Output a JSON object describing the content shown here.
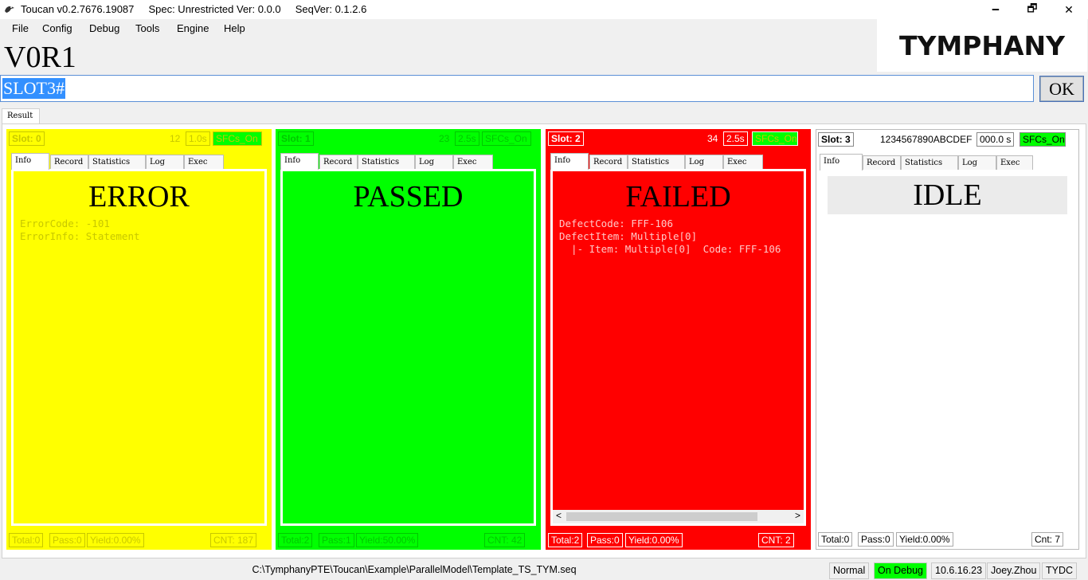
{
  "window": {
    "title": "Toucan v0.2.7676.19087     Spec: Unrestricted Ver: 0.0.0     SeqVer: 0.1.2.6",
    "minimize": "🗕",
    "maximize": "🗗",
    "close": "✕"
  },
  "menu": {
    "file": "File",
    "config": "Config",
    "debug": "Debug",
    "tools": "Tools",
    "engine": "Engine",
    "help": "Help"
  },
  "logo": {
    "text": "TYMPHANY"
  },
  "station": {
    "name": "V0R1"
  },
  "scan": {
    "value": "SLOT3#",
    "ok": "OK"
  },
  "result_tab": "Result",
  "tab_labels": [
    "Info",
    "Record",
    "Statistics",
    "Log",
    "Exec"
  ],
  "slots": [
    {
      "label": "Slot: 0",
      "count": "12",
      "time": "1.0s",
      "sfcs": "SFCs_On",
      "status": "ERROR",
      "lines": [
        "ErrorCode: -101",
        "ErrorInfo: Statement"
      ],
      "total": "Total:0",
      "pass": "Pass:0",
      "yield": "Yield:0.00%",
      "cnt": "CNT: 187",
      "bg": "#ffff00"
    },
    {
      "label": "Slot: 1",
      "count": "23",
      "time": "2.5s",
      "sfcs": "SFCs_On",
      "status": "PASSED",
      "lines": [],
      "total": "Total:2",
      "pass": "Pass:1",
      "yield": "Yield:50.00%",
      "cnt": "CNT: 42",
      "bg": "#00ff00"
    },
    {
      "label": "Slot: 2",
      "count": "34",
      "time": "2.5s",
      "sfcs": "SFCs_On",
      "status": "FAILED",
      "lines": [
        "DefectCode: FFF-106",
        "DefectItem: Multiple[0]",
        "  |- Item: Multiple[0]  Code: FFF-106"
      ],
      "total": "Total:2",
      "pass": "Pass:0",
      "yield": "Yield:0.00%",
      "cnt": "CNT: 2",
      "bg": "#ff0000"
    },
    {
      "label": "Slot: 3",
      "count": "1234567890ABCDEF",
      "time": "000.0 s",
      "sfcs": "SFCs_On",
      "status": "IDLE",
      "lines": [],
      "total": "Total:0",
      "pass": "Pass:0",
      "yield": "Yield:0.00%",
      "cnt": "Cnt: 7",
      "bg": "#ffffff"
    }
  ],
  "scroll": {
    "left": "<",
    "right": ">"
  },
  "statusbar": {
    "path": "C:\\TymphanyPTE\\Toucan\\Example\\ParallelModel\\Template_TS_TYM.seq",
    "mode": "Normal",
    "debug": "On Debug",
    "ip": "10.6.16.23",
    "user": "Joey.Zhou",
    "site": "TYDC"
  },
  "colors": {
    "error": "#ffff00",
    "passed": "#00ff00",
    "failed": "#ff0000",
    "sfcs_on": "#00ff00",
    "selection": "#3390ff"
  }
}
